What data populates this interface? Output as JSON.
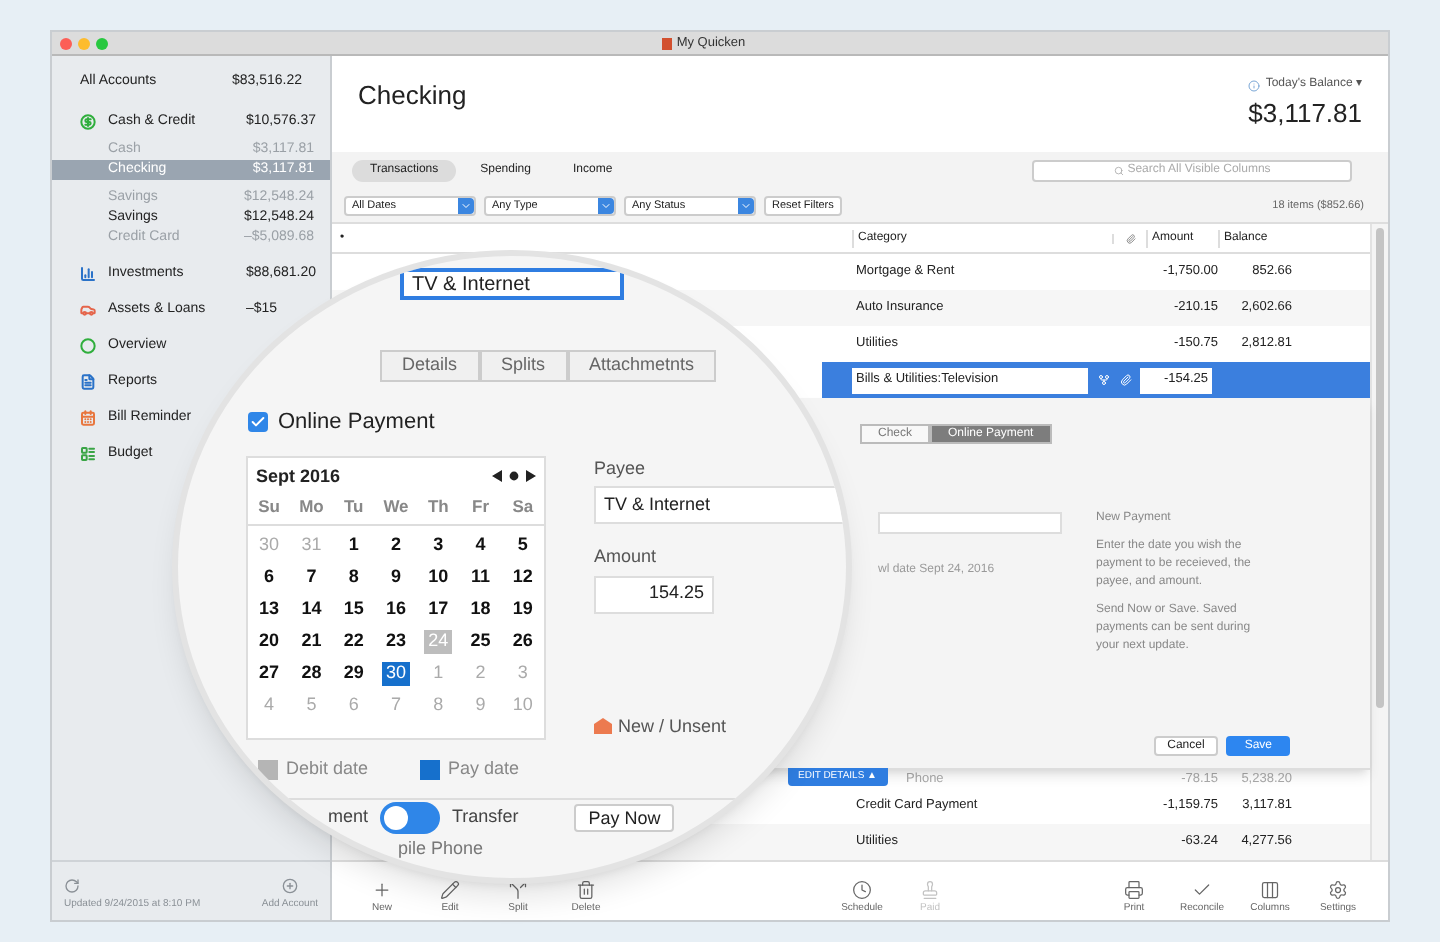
{
  "window": {
    "title": "My Quicken"
  },
  "sidebar": {
    "total": {
      "label": "All Accounts",
      "amount": "$83,516.22"
    },
    "sections": [
      {
        "label": "Cash & Credit",
        "amount": "$10,576.37",
        "children": [
          {
            "label": "Cash",
            "amount": "$3,117.81",
            "muted": true,
            "selected": false
          },
          {
            "label": "Checking",
            "amount": "$3,117.81",
            "muted": false,
            "selected": true
          },
          {
            "label": "Savings",
            "amount": "$12,548.24",
            "muted": true,
            "selected": false
          },
          {
            "label": "Savings",
            "amount": "$12,548.24",
            "muted": false,
            "selected": false
          },
          {
            "label": "Credit Card",
            "amount": "–$5,089.68",
            "muted": true,
            "selected": false
          }
        ]
      },
      {
        "label": "Investments",
        "amount": "$88,681.20"
      },
      {
        "label": "Assets & Loans",
        "amount": "–$15"
      },
      {
        "label": "Overview"
      },
      {
        "label": "Reports"
      },
      {
        "label": "Bill Reminder"
      },
      {
        "label": "Budget"
      }
    ],
    "updated": "Updated 9/24/2015 at 8:10 PM",
    "add_account": "Add Account"
  },
  "header": {
    "title": "Checking",
    "balance_label": "Today's Balance ▾",
    "balance": "$3,117.81"
  },
  "view_tabs": [
    {
      "label": "Transactions",
      "selected": true
    },
    {
      "label": "Spending",
      "selected": false
    },
    {
      "label": "Income",
      "selected": false
    }
  ],
  "search": {
    "placeholder": "Search All Visible Columns"
  },
  "filters": [
    {
      "label": "All Dates"
    },
    {
      "label": "Any Type"
    },
    {
      "label": "Any Status"
    }
  ],
  "reset_button": "Reset Filters",
  "item_count": "18 items ($852.66)",
  "table": {
    "columns": [
      "•",
      "Category",
      "Amount",
      "Balance"
    ],
    "rows": [
      {
        "category": "Mortgage & Rent",
        "amount": "-1,750.00",
        "balance": "852.66"
      },
      {
        "category": "Auto Insurance",
        "amount": "-210.15",
        "balance": "2,602.66"
      },
      {
        "category": "Utilities",
        "amount": "-150.75",
        "balance": "2,812.81"
      }
    ],
    "edit_row": {
      "category": "Bills & Utilities:Television",
      "amount": "-154.25"
    },
    "rows_after": [
      {
        "category": "Phone",
        "amount": "-78.15",
        "balance": "5,238.20"
      },
      {
        "category": "Credit Card Payment",
        "amount": "-1,159.75",
        "balance": "3,117.81"
      },
      {
        "category": "Utilities",
        "amount": "-63.24",
        "balance": "4,277.56"
      }
    ]
  },
  "form": {
    "tabs": [
      {
        "label": "Check",
        "selected": false
      },
      {
        "label": "Online Payment",
        "selected": true
      }
    ],
    "date_note": "wl date Sept 24, 2016",
    "info_title": "New Payment",
    "info": [
      "Enter the date you wish the payment to be receieved, the payee, and amount.",
      "Send Now or Save. Saved payments can be sent during your next update."
    ],
    "cancel": "Cancel",
    "save": "Save",
    "edit_details": "EDIT DETAILS ▲"
  },
  "toolbar": [
    {
      "label": "New",
      "disabled": false
    },
    {
      "label": "Edit",
      "disabled": false
    },
    {
      "label": "Split",
      "disabled": false
    },
    {
      "label": "Delete",
      "disabled": false
    },
    {
      "label": "Schedule",
      "disabled": false
    },
    {
      "label": "Paid",
      "disabled": true
    },
    {
      "label": "Print",
      "disabled": false
    },
    {
      "label": "Reconcile",
      "disabled": false
    },
    {
      "label": "Columns",
      "disabled": false
    },
    {
      "label": "Settings",
      "disabled": false
    }
  ],
  "magnifier": {
    "payee_row": "TV & Internet",
    "detail_tabs": [
      "Details",
      "Splits",
      "Attachmetnts"
    ],
    "online_payment": {
      "label": "Online Payment",
      "checked": true
    },
    "calendar": {
      "month": "Sept 2016",
      "weekdays": [
        "Su",
        "Mo",
        "Tu",
        "We",
        "Th",
        "Fr",
        "Sa"
      ],
      "weeks": [
        [
          {
            "day": "30",
            "kind": "outside"
          },
          {
            "day": "31",
            "kind": "outside"
          },
          {
            "day": "1",
            "kind": "normal"
          },
          {
            "day": "2",
            "kind": "normal"
          },
          {
            "day": "3",
            "kind": "normal"
          },
          {
            "day": "4",
            "kind": "normal"
          },
          {
            "day": "5",
            "kind": "normal"
          }
        ],
        [
          {
            "day": "6",
            "kind": "normal"
          },
          {
            "day": "7",
            "kind": "normal"
          },
          {
            "day": "8",
            "kind": "normal"
          },
          {
            "day": "9",
            "kind": "normal"
          },
          {
            "day": "10",
            "kind": "normal"
          },
          {
            "day": "11",
            "kind": "normal"
          },
          {
            "day": "12",
            "kind": "normal"
          }
        ],
        [
          {
            "day": "13",
            "kind": "normal"
          },
          {
            "day": "14",
            "kind": "normal"
          },
          {
            "day": "15",
            "kind": "normal"
          },
          {
            "day": "16",
            "kind": "normal"
          },
          {
            "day": "17",
            "kind": "normal"
          },
          {
            "day": "18",
            "kind": "normal"
          },
          {
            "day": "19",
            "kind": "normal"
          }
        ],
        [
          {
            "day": "20",
            "kind": "normal"
          },
          {
            "day": "21",
            "kind": "normal"
          },
          {
            "day": "22",
            "kind": "normal"
          },
          {
            "day": "23",
            "kind": "normal"
          },
          {
            "day": "24",
            "kind": "debit"
          },
          {
            "day": "25",
            "kind": "normal"
          },
          {
            "day": "26",
            "kind": "normal"
          }
        ],
        [
          {
            "day": "27",
            "kind": "normal"
          },
          {
            "day": "28",
            "kind": "normal"
          },
          {
            "day": "29",
            "kind": "normal"
          },
          {
            "day": "30",
            "kind": "pay"
          },
          {
            "day": "1",
            "kind": "outside"
          },
          {
            "day": "2",
            "kind": "outside"
          },
          {
            "day": "3",
            "kind": "outside"
          }
        ],
        [
          {
            "day": "4",
            "kind": "outside"
          },
          {
            "day": "5",
            "kind": "outside"
          },
          {
            "day": "6",
            "kind": "outside"
          },
          {
            "day": "7",
            "kind": "outside"
          },
          {
            "day": "8",
            "kind": "outside"
          },
          {
            "day": "9",
            "kind": "outside"
          },
          {
            "day": "10",
            "kind": "outside"
          }
        ]
      ]
    },
    "legend": [
      {
        "label": "Debit date",
        "color": "#b5b5b5"
      },
      {
        "label": "Pay date",
        "color": "#1670cc"
      }
    ],
    "payee": {
      "label": "Payee",
      "value": "TV & Internet"
    },
    "amount": {
      "label": "Amount",
      "value": "154.25"
    },
    "status": "New / Unsent",
    "toggle": {
      "left": "ment",
      "right": "Transfer",
      "on": false
    },
    "pay_now": "Pay Now",
    "next_row": "pile Phone"
  }
}
